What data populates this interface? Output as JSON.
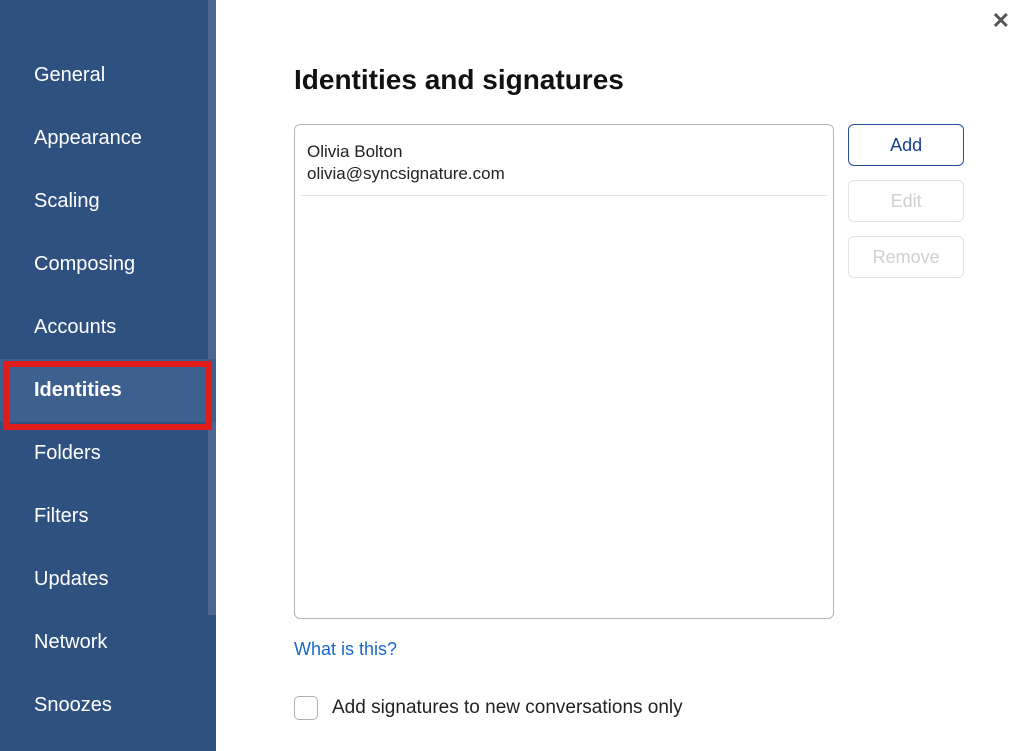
{
  "close_glyph": "✕",
  "sidebar": {
    "items": [
      {
        "label": "General"
      },
      {
        "label": "Appearance"
      },
      {
        "label": "Scaling"
      },
      {
        "label": "Composing"
      },
      {
        "label": "Accounts"
      },
      {
        "label": "Identities",
        "active": true,
        "highlighted": true
      },
      {
        "label": "Folders"
      },
      {
        "label": "Filters"
      },
      {
        "label": "Updates"
      },
      {
        "label": "Network"
      },
      {
        "label": "Snoozes"
      }
    ]
  },
  "main": {
    "title": "Identities and signatures",
    "identities": [
      {
        "name": "Olivia Bolton",
        "email": "olivia@syncsignature.com"
      }
    ],
    "buttons": {
      "add": "Add",
      "edit": "Edit",
      "remove": "Remove"
    },
    "help_link": "What is this?",
    "checkbox_label": "Add signatures to new conversations only",
    "checkbox_checked": false
  }
}
